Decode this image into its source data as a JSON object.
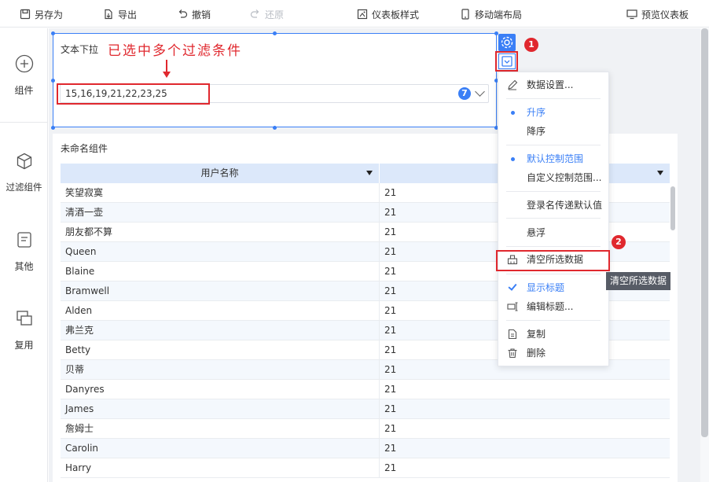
{
  "toolbar": {
    "save_as": "另存为",
    "export": "导出",
    "undo": "撤销",
    "redo": "还原",
    "dashboard_style": "仪表板样式",
    "mobile_layout": "移动端布局",
    "preview": "预览仪表板"
  },
  "sidebar": {
    "components": "组件",
    "filter_components": "过滤组件",
    "other": "其他",
    "reuse": "复用"
  },
  "filter_widget": {
    "title": "文本下拉",
    "annotation": "已选中多个过滤条件",
    "selected_value": "15,16,19,21,22,23,25",
    "selected_count": "7"
  },
  "callouts": {
    "one": "1",
    "two": "2"
  },
  "table_widget": {
    "title": "未命名组件",
    "columns": [
      "用户名称",
      ""
    ],
    "rows": [
      [
        "笑望寂寞",
        "21"
      ],
      [
        "清酒一壶",
        "21"
      ],
      [
        "朋友都不算",
        "21"
      ],
      [
        "Queen",
        "21"
      ],
      [
        "Blaine",
        "21"
      ],
      [
        "Bramwell",
        "21"
      ],
      [
        "Alden",
        "21"
      ],
      [
        "弗兰克",
        "21"
      ],
      [
        "Betty",
        "21"
      ],
      [
        "贝蒂",
        "21"
      ],
      [
        "Danyres",
        "21"
      ],
      [
        "James",
        "21"
      ],
      [
        "詹姆士",
        "21"
      ],
      [
        "Carolin",
        "21"
      ],
      [
        "Harry",
        "21"
      ]
    ]
  },
  "context_menu": {
    "data_settings": "数据设置...",
    "ascending": "升序",
    "descending": "降序",
    "default_control_range": "默认控制范围",
    "custom_control_range": "自定义控制范围...",
    "login_name_default": "登录名传递默认值",
    "float": "悬浮",
    "clear_selected": "清空所选数据",
    "show_title": "显示标题",
    "edit_title": "编辑标题...",
    "copy": "复制",
    "delete": "删除"
  },
  "tooltip": "清空所选数据",
  "colors": {
    "accent": "#3a7ff6",
    "annotation_red": "#e0282e",
    "header_bg": "#dce8fa"
  }
}
